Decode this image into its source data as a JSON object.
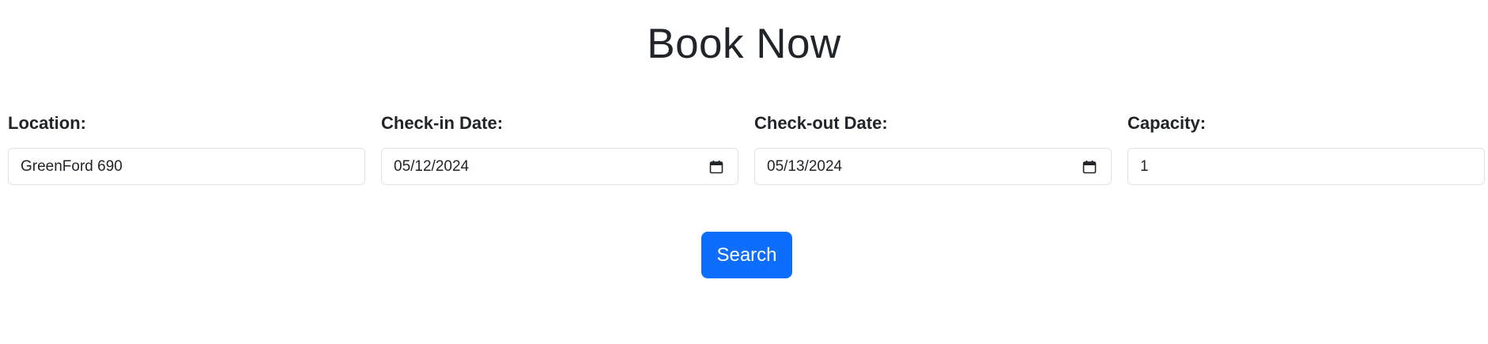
{
  "page": {
    "title": "Book Now"
  },
  "form": {
    "location": {
      "label": "Location:",
      "value": "GreenFord 690"
    },
    "checkin": {
      "label": "Check-in Date:",
      "value": "05/12/2024",
      "icon": "calendar-icon"
    },
    "checkout": {
      "label": "Check-out Date:",
      "value": "05/13/2024",
      "icon": "calendar-icon"
    },
    "capacity": {
      "label": "Capacity:",
      "value": "1"
    },
    "search_label": "Search"
  },
  "colors": {
    "primary": "#0d6efd",
    "text": "#212529",
    "border": "#dee2e6"
  }
}
